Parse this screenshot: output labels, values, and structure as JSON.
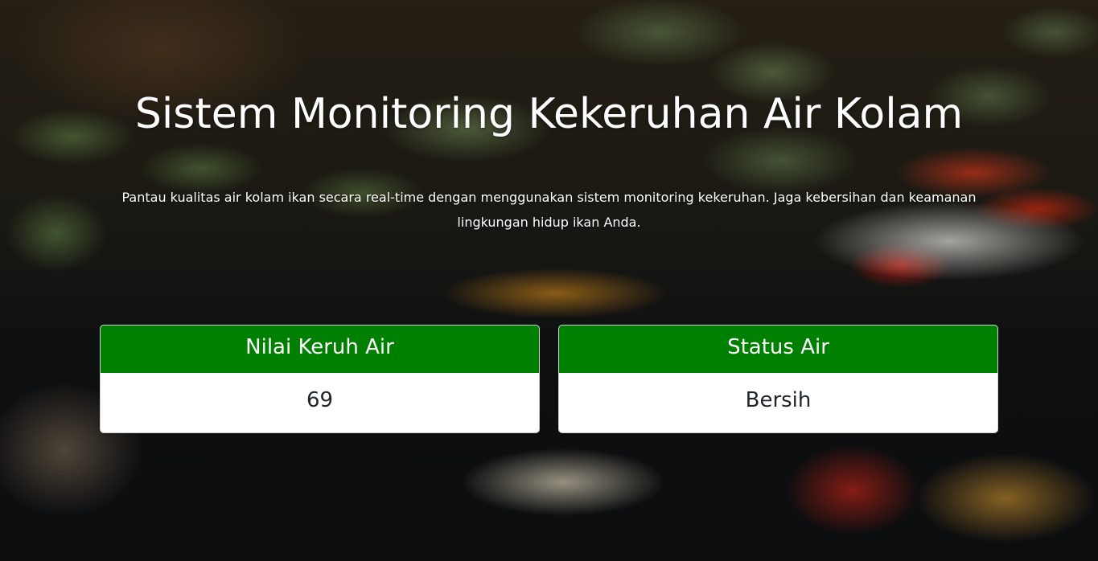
{
  "page": {
    "title": "Sistem Monitoring Kekeruhan Air Kolam",
    "description": "Pantau kualitas air kolam ikan secara real-time dengan menggunakan sistem monitoring kekeruhan. Jaga kebersihan dan keamanan lingkungan hidup ikan Anda."
  },
  "cards": {
    "turbidity": {
      "header": "Nilai Keruh Air",
      "value": "69"
    },
    "status": {
      "header": "Status Air",
      "value": "Bersih"
    }
  },
  "colors": {
    "card_header": "#008000",
    "card_body": "#ffffff",
    "heading_text": "#ffffff",
    "value_text": "#212529"
  },
  "background": {
    "icon": "koi-pond-photo"
  }
}
